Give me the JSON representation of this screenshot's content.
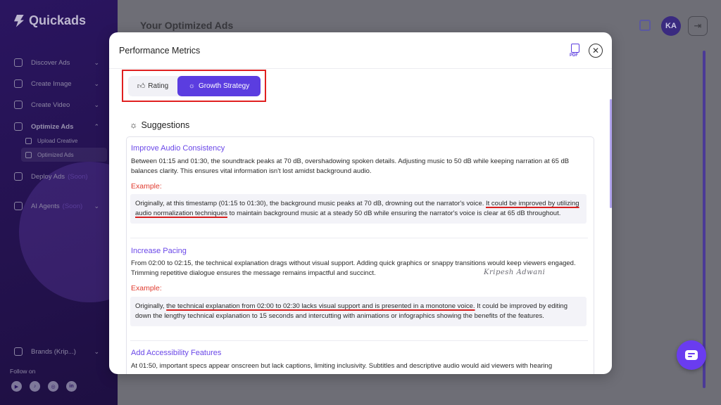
{
  "app": {
    "name": "Quickads",
    "page_title": "Your Optimized Ads",
    "avatar_initials": "KA"
  },
  "sidebar": {
    "items": [
      {
        "label": "Discover Ads"
      },
      {
        "label": "Create Image"
      },
      {
        "label": "Create Video"
      },
      {
        "label": "Optimize Ads"
      },
      {
        "label": "Deploy Ads",
        "badge": "(Soon)"
      },
      {
        "label": "AI Agents",
        "badge": "(Soon)"
      }
    ],
    "sub_items": [
      {
        "label": "Upload Creative"
      },
      {
        "label": "Optimized Ads"
      }
    ],
    "brands_label": "Brands (Krip...)",
    "follow_label": "Follow on",
    "socials": [
      "yt",
      "tk",
      "ig",
      "in"
    ]
  },
  "modal": {
    "title": "Performance Metrics",
    "pdf_label": "PDF",
    "tabs": [
      {
        "label": "Rating",
        "active": false
      },
      {
        "label": "Growth Strategy",
        "active": true
      }
    ],
    "suggestions_title": "Suggestions",
    "sections": [
      {
        "title": "Improve Audio Consistency",
        "text": "Between 01:15 and 01:30, the soundtrack peaks at 70 dB, overshadowing spoken details. Adjusting music to 50 dB while keeping narration at 65 dB balances clarity. This ensures vital information isn't lost amidst background audio.",
        "example_label": "Example:",
        "example_before": "Originally, at this timestamp (01:15 to 01:30), the background music peaks at 70 dB, drowning out the narrator's voice. ",
        "example_highlight": "It could be improved by utilizing audio normalization techniques",
        "example_after": " to maintain background music at a steady 50 dB while ensuring the narrator's voice is clear at 65 dB throughout."
      },
      {
        "title": "Increase Pacing",
        "text": "From 02:00 to 02:15, the technical explanation drags without visual support. Adding quick graphics or snappy transitions would keep viewers engaged. Trimming repetitive dialogue ensures the message remains impactful and succinct.",
        "example_label": "Example:",
        "example_before": "Originally, ",
        "example_highlight": "the technical explanation from 02:00 to 02:30 lacks visual support and is presented in a monotone voice.",
        "example_after": " It could be improved by editing down the lengthy technical explanation to 15 seconds and intercutting with animations or infographics showing the benefits of the features."
      },
      {
        "title": "Add Accessibility Features",
        "text": "At 01:50, important specs appear onscreen but lack captions, limiting inclusivity. Subtitles and descriptive audio would aid viewers with hearing"
      }
    ],
    "signature": "Kripesh Adwani"
  },
  "colors": {
    "accent": "#5b3de0",
    "example_red": "#e03a2e",
    "highlight_box": "#e02020",
    "sidebar": "#2a1560"
  }
}
